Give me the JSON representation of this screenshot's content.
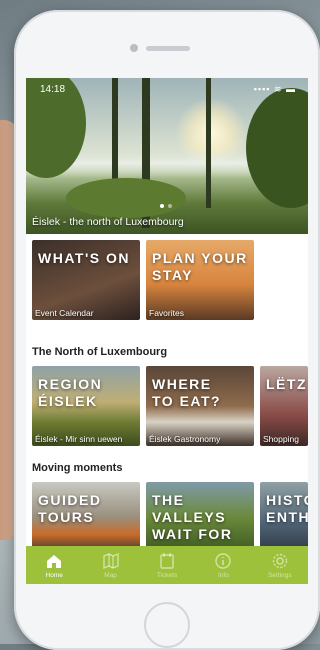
{
  "status": {
    "time": "14:18",
    "signal": "▪▪▪▪ ≋ ▬"
  },
  "hero": {
    "caption": "Éislek - the north of Luxembourg"
  },
  "top_tiles": [
    {
      "title": "WHAT'S ON",
      "subtitle": "Event Calendar"
    },
    {
      "title": "PLAN YOUR STAY",
      "subtitle": "Favorites"
    }
  ],
  "sections": [
    {
      "title": "The North of Luxembourg",
      "tiles": [
        {
          "title": "REGION ÉISLEK",
          "subtitle": "Éislek - Mir sinn uewen"
        },
        {
          "title": "WHERE TO EAT?",
          "subtitle": "Éislek Gastronomy"
        },
        {
          "title": "LËTZ",
          "subtitle": "Shopping"
        }
      ]
    },
    {
      "title": "Moving moments",
      "tiles": [
        {
          "title": "GUIDED TOURS",
          "subtitle": ""
        },
        {
          "title": "THE VALLEYS WAIT FOR YOU",
          "subtitle": ""
        },
        {
          "title": "HISTO ENTH",
          "subtitle": ""
        }
      ]
    }
  ],
  "tabs": [
    {
      "label": "Home",
      "icon": "home-icon",
      "active": true
    },
    {
      "label": "Map",
      "icon": "map-icon",
      "active": false
    },
    {
      "label": "Tickets",
      "icon": "tickets-icon",
      "active": false
    },
    {
      "label": "Info",
      "icon": "info-icon",
      "active": false
    },
    {
      "label": "Settings",
      "icon": "settings-icon",
      "active": false
    }
  ],
  "colors": {
    "accent": "#9dc13b"
  }
}
